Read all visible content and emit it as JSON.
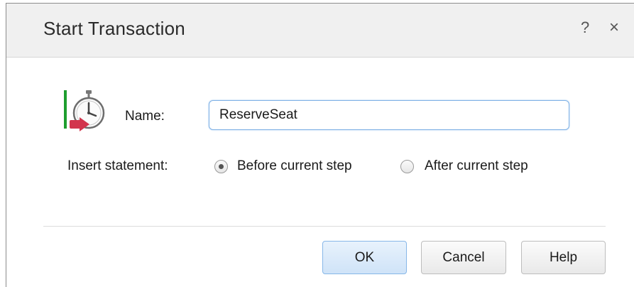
{
  "dialog": {
    "title": "Start Transaction",
    "help_glyph": "?",
    "close_glyph": "×"
  },
  "icon": {
    "name": "start-transaction-icon"
  },
  "form": {
    "name_label": "Name:",
    "name_value": "ReserveSeat",
    "insert_label": "Insert statement:",
    "options": [
      {
        "label": "Before current step",
        "selected": true
      },
      {
        "label": "After current step",
        "selected": false
      }
    ]
  },
  "buttons": {
    "ok": "OK",
    "cancel": "Cancel",
    "help": "Help"
  },
  "colors": {
    "titlebar_bg": "#f0f0f0",
    "input_focus_border": "#7fb1e5",
    "icon_green_bar": "#1e9e2e",
    "icon_red_arrow": "#d2354d"
  }
}
